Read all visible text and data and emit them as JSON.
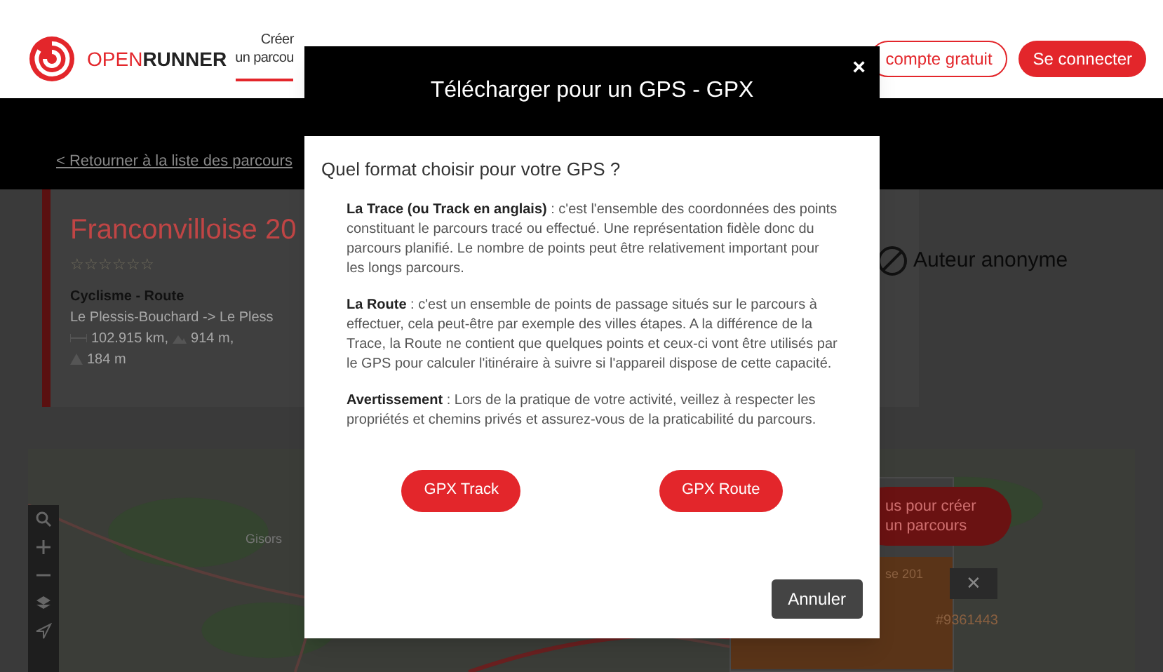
{
  "top_bar": {
    "brand_light": "OPEN",
    "brand_bold": "RUNNER",
    "nav": [
      {
        "lines": [
          "Créer",
          "un parcou"
        ],
        "selected": true
      }
    ],
    "buttons": [
      {
        "label": "compte gratuit",
        "kind": "outline"
      },
      {
        "label": "Se connecter",
        "kind": "filled"
      }
    ]
  },
  "page": {
    "back_link": "< Retourner à la liste des parcours",
    "route": {
      "title": "Franconvilloise 20",
      "stars": 0,
      "sport": "Cyclisme - Route",
      "places": "Le Plessis-Bouchard  -> Le Pless",
      "distance": "102.915 km,",
      "climb": "914 m,",
      "altitude": "184 m"
    },
    "author": "Auteur anonyme",
    "map": {
      "place": "Gisors"
    },
    "side": {
      "create_lines": [
        "us pour créer",
        "un parcours"
      ],
      "item_title": "se 201",
      "item_id": "#9361443",
      "close": "✕"
    }
  },
  "modal": {
    "title": "Télécharger pour un GPS - GPX",
    "close": "×",
    "question": "Quel format choisir pour votre GPS ?",
    "paragraphs": [
      "**La Trace (ou Track en anglais)** : c'est l'ensemble des coordonnées des points constituant le parcours tracé ou effectué. Une représentation fidèle donc du parcours planifié. Le nombre de points peut être relativement important pour les longs parcours.",
      "**La Route** : c'est un ensemble de points de passage situés sur le parcours à effectuer, cela peut-être par exemple des villes étapes. A la différence de la Trace, la Route ne contient que quelques points et ceux-ci vont être utilisés par le GPS pour calculer l'itinéraire à suivre si l'appareil dispose de cette capacité.",
      "**Avertissement** : Lors de la pratique de votre activité, veillez à respecter les propriétés et chemins privés et assurez-vous de la praticabilité du parcours."
    ],
    "buttons": [
      "GPX Track",
      "GPX Route"
    ],
    "cancel": "Annuler"
  }
}
